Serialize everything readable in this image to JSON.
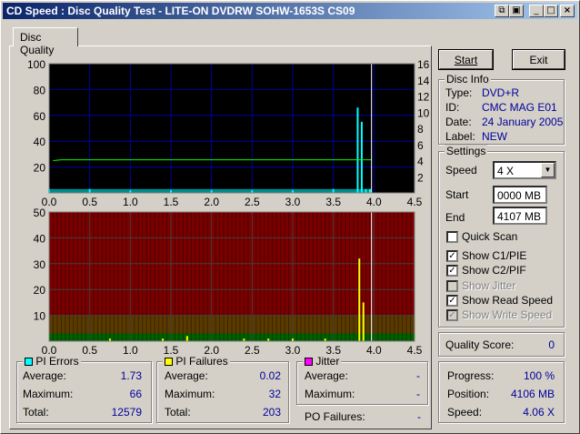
{
  "window": {
    "title": "CD Speed : Disc Quality Test - LITE-ON DVDRW SOHW-1653S CS09"
  },
  "tab": {
    "label": "Disc Quality"
  },
  "buttons": {
    "start": "Start",
    "exit": "Exit"
  },
  "disc_info": {
    "legend": "Disc Info",
    "type_label": "Type:",
    "type_value": "DVD+R",
    "id_label": "ID:",
    "id_value": "CMC MAG E01",
    "date_label": "Date:",
    "date_value": "24 January 2005",
    "label_label": "Label:",
    "label_value": "NEW"
  },
  "settings": {
    "legend": "Settings",
    "speed_label": "Speed",
    "speed_value": "4 X",
    "start_label": "Start",
    "start_value": "0000 MB",
    "end_label": "End",
    "end_value": "4107 MB",
    "quick_scan": "Quick Scan",
    "quick_scan_checked": false,
    "show_c1": "Show C1/PIE",
    "show_c1_checked": true,
    "show_c2": "Show C2/PIF",
    "show_c2_checked": true,
    "show_jitter": "Show Jitter",
    "show_jitter_checked": false,
    "show_read": "Show Read Speed",
    "show_read_checked": true,
    "show_write": "Show Write Speed",
    "show_write_checked": true
  },
  "quality": {
    "label": "Quality Score:",
    "value": "0"
  },
  "progress": {
    "progress_label": "Progress:",
    "progress_value": "100 %",
    "position_label": "Position:",
    "position_value": "4106 MB",
    "speed_label": "Speed:",
    "speed_value": "4.06 X"
  },
  "pi_errors": {
    "legend": "PI Errors",
    "color": "#00ffff",
    "avg_label": "Average:",
    "avg": "1.73",
    "max_label": "Maximum:",
    "max": "66",
    "total_label": "Total:",
    "total": "12579"
  },
  "pi_failures": {
    "legend": "PI Failures",
    "color": "#ffff00",
    "avg_label": "Average:",
    "avg": "0.02",
    "max_label": "Maximum:",
    "max": "32",
    "total_label": "Total:",
    "total": "203"
  },
  "jitter": {
    "legend": "Jitter",
    "color": "#ff00ff",
    "avg_label": "Average:",
    "avg": "-",
    "max_label": "Maximum:",
    "max": "-"
  },
  "po_failures": {
    "label": "PO Failures:",
    "value": "-"
  },
  "chart_data": [
    {
      "type": "bar",
      "xlim": [
        0,
        4.5
      ],
      "ylim": [
        0,
        100
      ],
      "y2lim": [
        0,
        16
      ],
      "xticks": [
        "0.0",
        "0.5",
        "1.0",
        "1.5",
        "2.0",
        "2.5",
        "3.0",
        "3.5",
        "4.0",
        "4.5"
      ],
      "yticks": [
        "20",
        "40",
        "60",
        "80",
        "100"
      ],
      "y2ticks": [
        "2",
        "4",
        "6",
        "8",
        "10",
        "12",
        "14",
        "16"
      ],
      "background": "#000000",
      "grid_color": "#0000a0",
      "series": [
        {
          "name": "PI Errors",
          "color": "#00ffff",
          "x": [
            0.0,
            0.5,
            1.0,
            1.5,
            2.0,
            2.5,
            3.0,
            3.5,
            3.8,
            3.85,
            3.9,
            3.95
          ],
          "values": [
            3,
            3,
            2,
            2,
            2,
            2,
            2,
            3,
            66,
            55,
            3,
            3
          ]
        },
        {
          "name": "Read Speed",
          "color": "#00ff00",
          "x": [
            0.05,
            0.15,
            3.97
          ],
          "values": [
            4.0,
            4.1,
            4.1
          ]
        }
      ],
      "end_marker_x": 3.97
    },
    {
      "type": "bar",
      "xlim": [
        0,
        4.5
      ],
      "ylim": [
        0,
        50
      ],
      "xticks": [
        "0.0",
        "0.5",
        "1.0",
        "1.5",
        "2.0",
        "2.5",
        "3.0",
        "3.5",
        "4.0",
        "4.5"
      ],
      "yticks": [
        "10",
        "20",
        "30",
        "40",
        "50"
      ],
      "bands": [
        {
          "from": 0,
          "to": 3,
          "color": "#006000"
        },
        {
          "from": 3,
          "to": 10,
          "color": "#5a3a00"
        },
        {
          "from": 10,
          "to": 50,
          "color": "#7a0000"
        }
      ],
      "series": [
        {
          "name": "PI Failures",
          "color": "#ffff00",
          "x": [
            0.75,
            1.4,
            1.7,
            2.4,
            2.7,
            3.0,
            3.4,
            3.82,
            3.87
          ],
          "values": [
            1,
            1,
            2,
            1,
            1,
            1,
            1,
            32,
            15
          ]
        }
      ],
      "end_marker_x": 3.97
    }
  ]
}
